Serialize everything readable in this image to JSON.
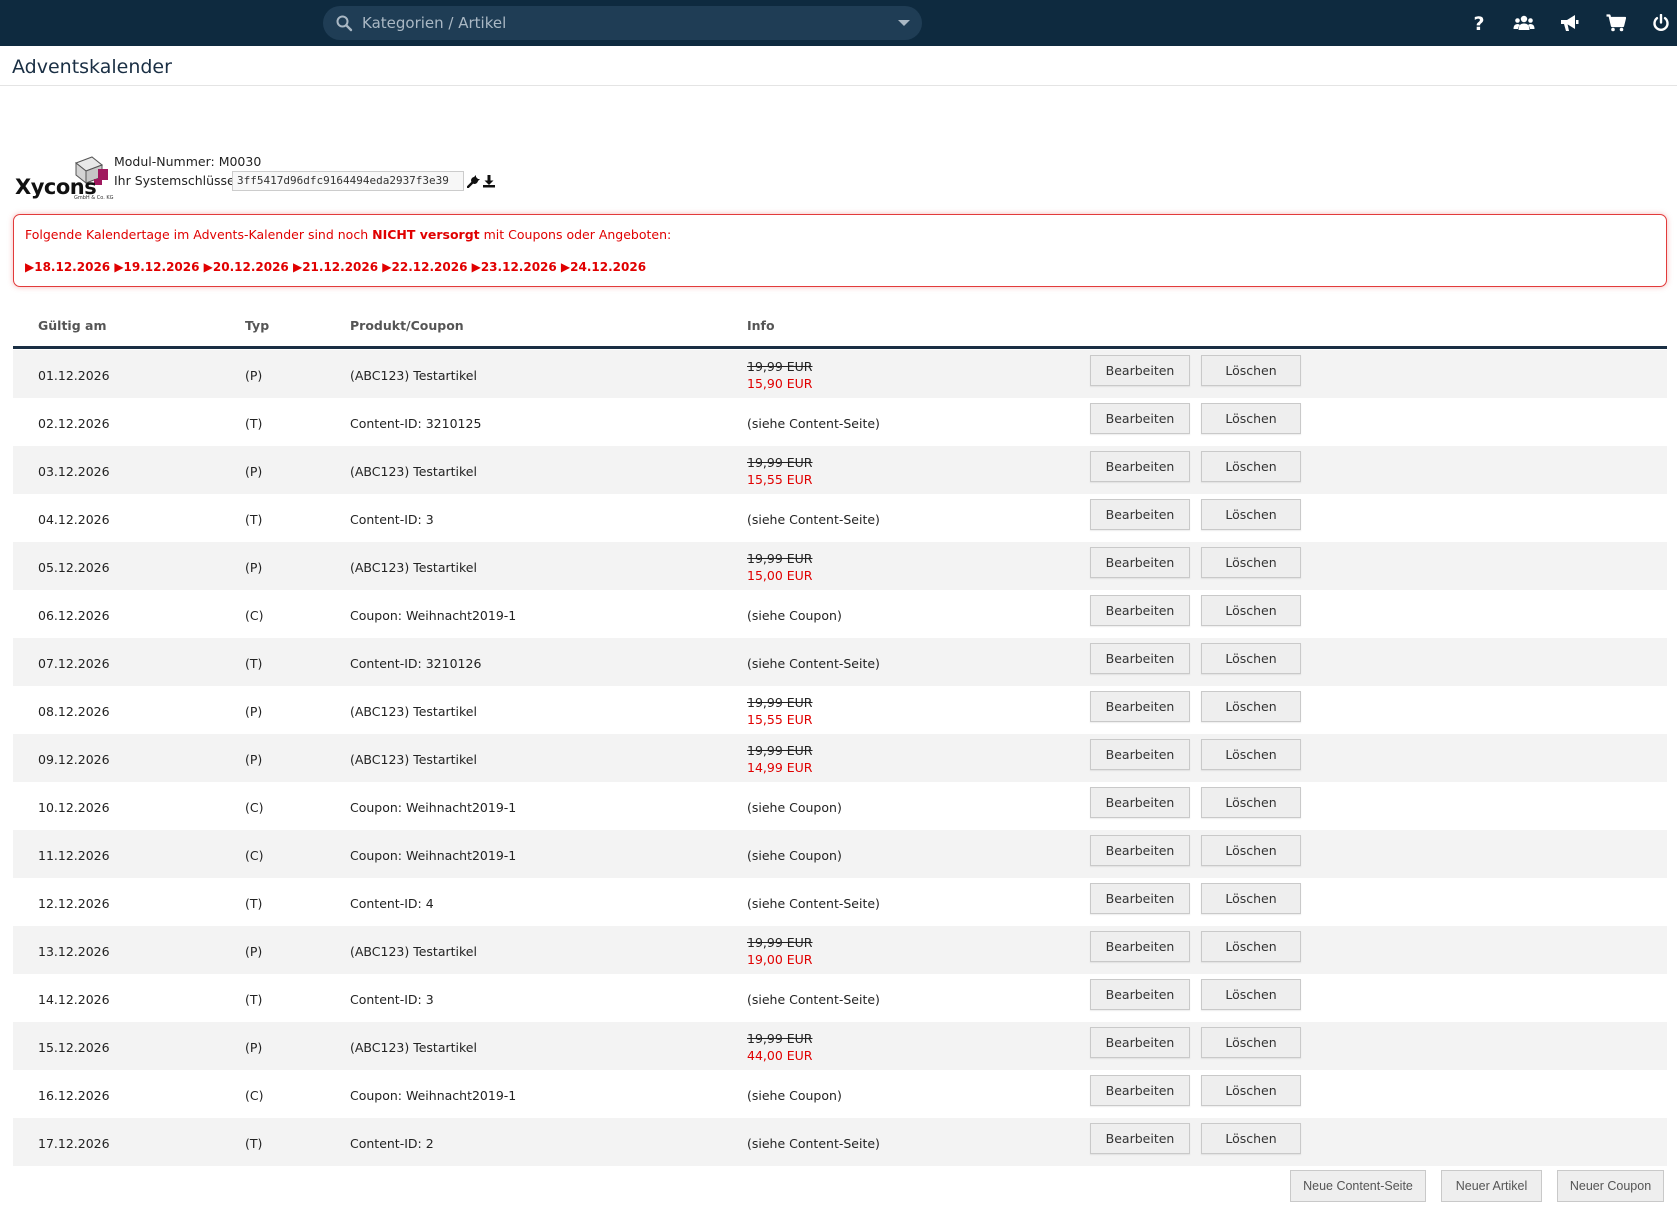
{
  "search": {
    "placeholder": "Kategorien / Artikel"
  },
  "topbar_icons": [
    "help-icon",
    "users-icon",
    "megaphone-icon",
    "cart-icon",
    "power-icon"
  ],
  "page": {
    "title": "Adventskalender"
  },
  "module": {
    "logo_text": "Xycons",
    "logo_sub": "GmbH & Co. KG",
    "number_label": "Modul-Nummer: M0030",
    "syskey_label": "Ihr Systemschlüssel:",
    "syskey_value": "3ff5417d96dfc9164494eda2937f3e39"
  },
  "alert": {
    "prefix": "Folgende Kalendertage im Advents-Kalender sind noch ",
    "emphasis": "NICHT versorgt",
    "suffix": " mit Coupons oder Angeboten:",
    "dates": "▶18.12.2026 ▶19.12.2026 ▶20.12.2026 ▶21.12.2026 ▶22.12.2026 ▶23.12.2026 ▶24.12.2026"
  },
  "table": {
    "headers": {
      "date": "Gültig am",
      "typ": "Typ",
      "prod": "Produkt/Coupon",
      "info": "Info"
    },
    "edit_label": "Bearbeiten",
    "delete_label": "Löschen",
    "rows": [
      {
        "date": "01.12.2026",
        "typ": "(P)",
        "prod": "(ABC123) Testartikel",
        "old": "19,99 EUR",
        "new": "15,90 EUR"
      },
      {
        "date": "02.12.2026",
        "typ": "(T)",
        "prod": "Content-ID: 3210125",
        "info": "(siehe Content-Seite)"
      },
      {
        "date": "03.12.2026",
        "typ": "(P)",
        "prod": "(ABC123) Testartikel",
        "old": "19,99 EUR",
        "new": "15,55 EUR"
      },
      {
        "date": "04.12.2026",
        "typ": "(T)",
        "prod": "Content-ID: 3",
        "info": "(siehe Content-Seite)"
      },
      {
        "date": "05.12.2026",
        "typ": "(P)",
        "prod": "(ABC123) Testartikel",
        "old": "19,99 EUR",
        "new": "15,00 EUR"
      },
      {
        "date": "06.12.2026",
        "typ": "(C)",
        "prod": "Coupon: Weihnacht2019-1",
        "info": "(siehe Coupon)"
      },
      {
        "date": "07.12.2026",
        "typ": "(T)",
        "prod": "Content-ID: 3210126",
        "info": "(siehe Content-Seite)"
      },
      {
        "date": "08.12.2026",
        "typ": "(P)",
        "prod": "(ABC123) Testartikel",
        "old": "19,99 EUR",
        "new": "15,55 EUR"
      },
      {
        "date": "09.12.2026",
        "typ": "(P)",
        "prod": "(ABC123) Testartikel",
        "old": "19,99 EUR",
        "new": "14,99 EUR"
      },
      {
        "date": "10.12.2026",
        "typ": "(C)",
        "prod": "Coupon: Weihnacht2019-1",
        "info": "(siehe Coupon)"
      },
      {
        "date": "11.12.2026",
        "typ": "(C)",
        "prod": "Coupon: Weihnacht2019-1",
        "info": "(siehe Coupon)"
      },
      {
        "date": "12.12.2026",
        "typ": "(T)",
        "prod": "Content-ID: 4",
        "info": "(siehe Content-Seite)"
      },
      {
        "date": "13.12.2026",
        "typ": "(P)",
        "prod": "(ABC123) Testartikel",
        "old": "19,99 EUR",
        "new": "19,00 EUR"
      },
      {
        "date": "14.12.2026",
        "typ": "(T)",
        "prod": "Content-ID: 3",
        "info": "(siehe Content-Seite)"
      },
      {
        "date": "15.12.2026",
        "typ": "(P)",
        "prod": "(ABC123) Testartikel",
        "old": "19,99 EUR",
        "new": "44,00 EUR"
      },
      {
        "date": "16.12.2026",
        "typ": "(C)",
        "prod": "Coupon: Weihnacht2019-1",
        "info": "(siehe Coupon)"
      },
      {
        "date": "17.12.2026",
        "typ": "(T)",
        "prod": "Content-ID: 2",
        "info": "(siehe Content-Seite)"
      }
    ]
  },
  "footer": {
    "new_content": "Neue Content-Seite",
    "new_article": "Neuer Artikel",
    "new_coupon": "Neuer Coupon"
  },
  "colors": {
    "topbar": "#0e2a3f",
    "alert_red": "#e00000",
    "header_rule": "#1a2f44"
  }
}
